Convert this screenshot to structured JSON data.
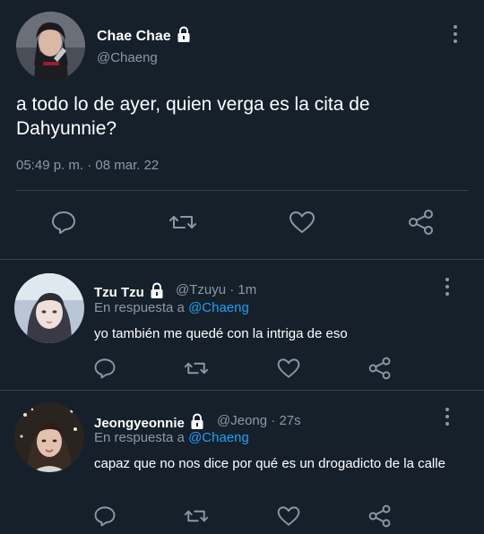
{
  "main_tweet": {
    "display_name": "Chae Chae",
    "handle": "@Chaeng",
    "text": "a todo lo de ayer, quien verga es la cita de Dahyunnie?",
    "timestamp": "05:49 p. m. · 08 mar. 22"
  },
  "replies": [
    {
      "display_name": "Tzu Tzu",
      "handle": "@Tzuyu",
      "time": "1m",
      "reply_prefix": "En respuesta a",
      "reply_mention": "@Chaeng",
      "text": "yo también me quedé con la intriga de eso"
    },
    {
      "display_name": "Jeongyeonnie",
      "handle": "@Jeong",
      "time": "27s",
      "reply_prefix": "En respuesta a",
      "reply_mention": "@Chaeng",
      "text": "capaz que no nos dice por qué es un drogadicto de la calle"
    }
  ],
  "meta_separator": "·",
  "icons": {
    "reply": "reply-icon",
    "retweet": "retweet-icon",
    "like": "heart-icon",
    "share": "share-icon",
    "more": "more-vertical-icon",
    "lock": "lock-icon"
  },
  "colors": {
    "background": "#15202b",
    "text": "#ffffff",
    "secondary": "#8899a6",
    "link": "#1da1f2",
    "divider": "#38444d"
  }
}
